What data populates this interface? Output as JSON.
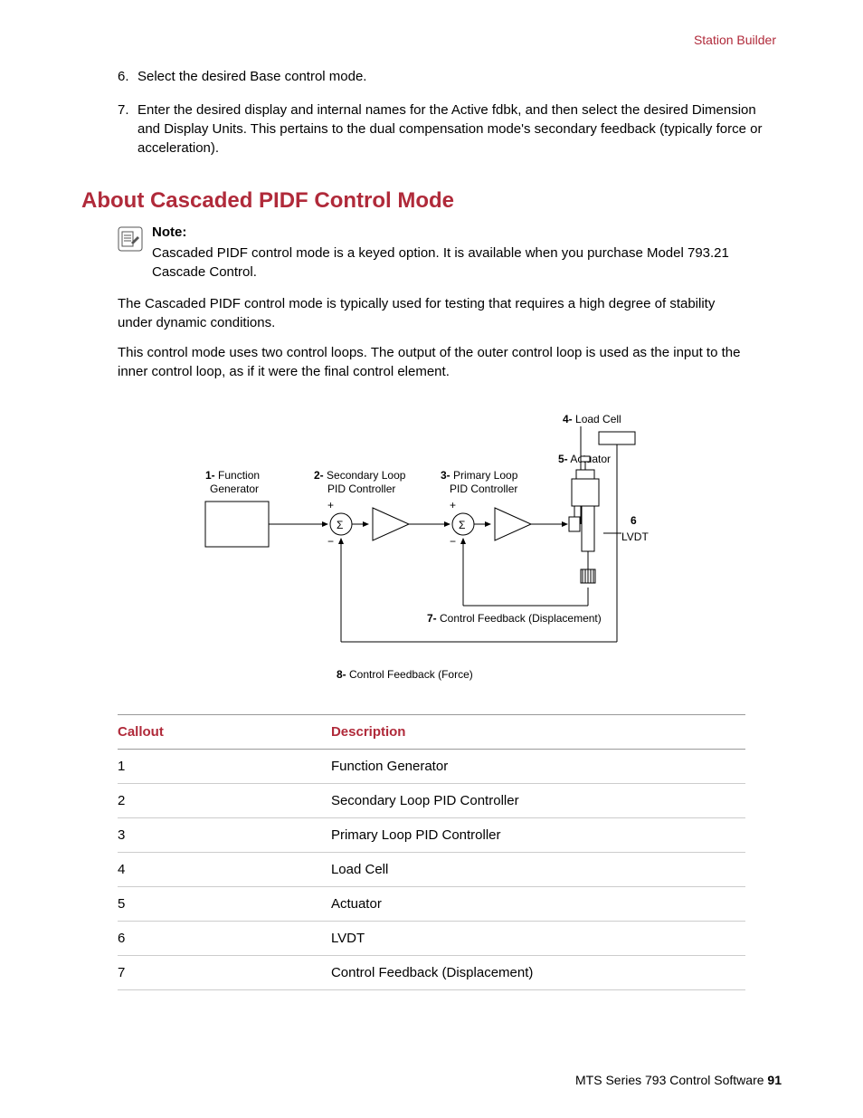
{
  "header": {
    "breadcrumb": "Station Builder"
  },
  "list": {
    "items": [
      {
        "num": "6.",
        "text": "Select the desired Base control mode."
      },
      {
        "num": "7.",
        "text": "Enter the desired display and internal names for the Active fdbk, and then select the desired Dimension and Display Units. This pertains to the dual compensation mode's secondary feedback (typically force or acceleration)."
      }
    ]
  },
  "heading": "About Cascaded PIDF Control Mode",
  "note": {
    "title": "Note:",
    "text": "Cascaded PIDF control mode is a keyed option. It is available when you purchase Model 793.21 Cascade Control."
  },
  "paragraphs": [
    "The Cascaded PIDF control mode is typically used for testing that requires a high degree of stability under dynamic conditions.",
    "This control mode uses two control loops. The output of the outer control loop is used as the input to the inner control loop, as if it were the final control element."
  ],
  "diagram": {
    "labels": {
      "l1_num": "1-",
      "l1_a": "Function",
      "l1_b": "Generator",
      "l2_num": "2-",
      "l2_a": "Secondary Loop",
      "l2_b": "PID Controller",
      "l3_num": "3-",
      "l3_a": "Primary Loop",
      "l3_b": "PID Controller",
      "l4_num": "4-",
      "l4": "Load Cell",
      "l5_num": "5-",
      "l5": "Actuator",
      "l6_num": "6",
      "l6": "LVDT",
      "l7_num": "7-",
      "l7": "Control Feedback (Displacement)",
      "l8_num": "8-",
      "l8": "Control Feedback (Force)",
      "sigma": "Σ",
      "plus": "+",
      "minus": "−"
    }
  },
  "table": {
    "headers": [
      "Callout",
      "Description"
    ],
    "rows": [
      [
        "1",
        "Function Generator"
      ],
      [
        "2",
        "Secondary Loop PID Controller"
      ],
      [
        "3",
        "Primary Loop PID Controller"
      ],
      [
        "4",
        "Load Cell"
      ],
      [
        "5",
        "Actuator"
      ],
      [
        "6",
        "LVDT"
      ],
      [
        "7",
        "Control Feedback (Displacement)"
      ]
    ]
  },
  "footer": {
    "text": "MTS Series 793 Control Software ",
    "page": "91"
  }
}
